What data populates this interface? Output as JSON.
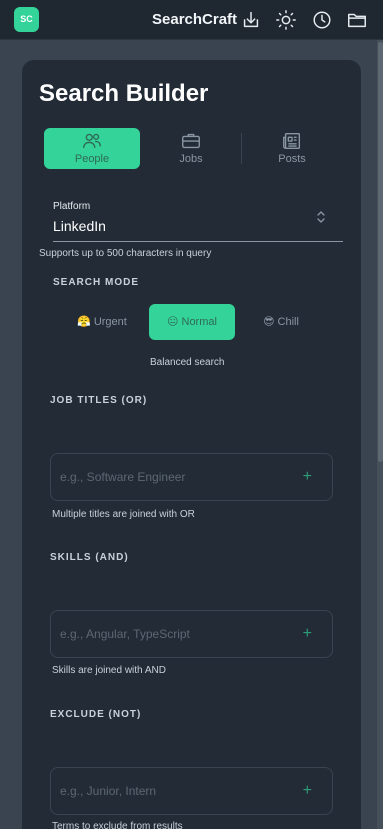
{
  "header": {
    "logo": "SC",
    "title": "SearchCraft",
    "icons": [
      "download-icon",
      "sun-icon",
      "history-icon",
      "folder-icon"
    ]
  },
  "card": {
    "title": "Search Builder",
    "tabs": [
      {
        "label": "People",
        "icon": "people-icon",
        "active": true
      },
      {
        "label": "Jobs",
        "icon": "briefcase-icon",
        "active": false
      },
      {
        "label": "Posts",
        "icon": "newspaper-icon",
        "active": false
      }
    ],
    "platform": {
      "label": "Platform",
      "value": "LinkedIn",
      "helper": "Supports up to 500 characters in query"
    },
    "search_mode": {
      "label": "SEARCH MODE",
      "options": [
        {
          "label": "Urgent",
          "emoji": "😤",
          "active": false
        },
        {
          "label": "Normal",
          "emoji": "😐",
          "active": true
        },
        {
          "label": "Chill",
          "emoji": "😎",
          "active": false
        }
      ],
      "description": "Balanced search"
    },
    "job_titles": {
      "label": "JOB TITLES (OR)",
      "placeholder": "e.g., Software Engineer",
      "helper": "Multiple titles are joined with OR"
    },
    "skills": {
      "label": "SKILLS (AND)",
      "placeholder": "e.g., Angular, TypeScript",
      "helper": "Skills are joined with AND"
    },
    "exclude": {
      "label": "EXCLUDE (NOT)",
      "placeholder": "e.g., Junior, Intern",
      "helper": "Terms to exclude from results"
    },
    "add_symbol": "+"
  },
  "colors": {
    "accent": "#34d399",
    "card_bg": "#222b36",
    "page_bg": "#3a4450",
    "header_bg": "#1f2730"
  }
}
